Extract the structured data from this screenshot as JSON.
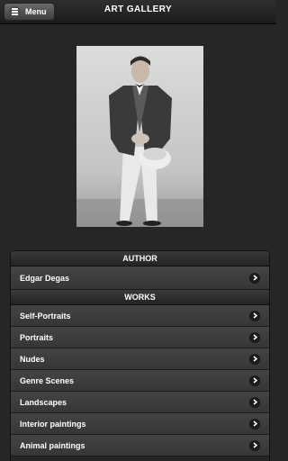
{
  "header": {
    "title": "ART GALLERY",
    "menu_label": "Menu"
  },
  "author_section": {
    "heading": "AUTHOR",
    "items": [
      {
        "label": "Edgar Degas"
      }
    ]
  },
  "works_section": {
    "heading": "WORKS",
    "items": [
      {
        "label": "Self-Portraits"
      },
      {
        "label": "Portraits"
      },
      {
        "label": "Nudes"
      },
      {
        "label": "Genre Scenes"
      },
      {
        "label": "Landscapes"
      },
      {
        "label": "Interior paintings"
      },
      {
        "label": "Animal paintings"
      }
    ]
  },
  "icons": {
    "menu": "menu-icon",
    "item_arrow": "chevron-right-icon"
  },
  "colors": {
    "background": "#262626",
    "row": "#3d3d3d",
    "text": "#ffffff"
  }
}
